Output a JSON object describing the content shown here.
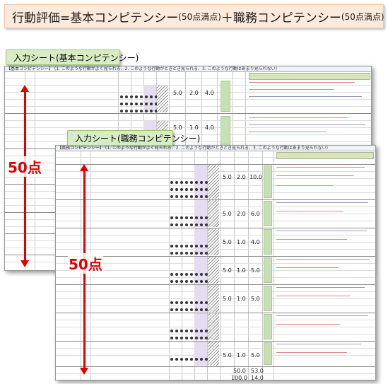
{
  "title": {
    "part1": "行動評価=基本コンピテンシー",
    "part2": "(50点満点)",
    "part3": "＋職務コンピテンシー",
    "part4": "(50点満点)"
  },
  "tabs": {
    "basic": "入力シート(基本コンピテンシー)",
    "job": "入力シート(職務コンピテンシー)"
  },
  "labels": {
    "basic_points": "50点",
    "job_points": "50点"
  },
  "basic_sheet": {
    "header": "【基本コンピテンシー】 (1. このような行動がよく見られる、2. このような行動がときどき見られる、3. このような行動はあまり見られない)",
    "scores": [
      {
        "a": "5.0",
        "b": "2.0",
        "c": "4.0"
      },
      {
        "a": "5.0",
        "b": "1.0",
        "c": "4.0"
      }
    ]
  },
  "job_sheet": {
    "header": "【職務コンピテンシー】 (1. このような行動がよく見られる、2. このような行動がときどき見られる、3. このような行動はあまり見られない)",
    "group_scores": [
      {
        "a": "5.0",
        "b": "2.0",
        "c": "10.0"
      },
      {
        "a": "5.0",
        "b": "2.0",
        "c": "6.0"
      },
      {
        "a": "5.0",
        "b": "1.0",
        "c": "4.0"
      },
      {
        "a": "5.0",
        "b": "1.0",
        "c": "5.0"
      },
      {
        "a": "5.0",
        "b": "1.0",
        "c": "5.0"
      },
      {
        "a": "5.0",
        "b": "1.0",
        "c": "5.0"
      }
    ],
    "totals": [
      {
        "a": "50.0",
        "b": "53.0"
      },
      {
        "a": "100.0",
        "b": "14.0"
      }
    ]
  }
}
